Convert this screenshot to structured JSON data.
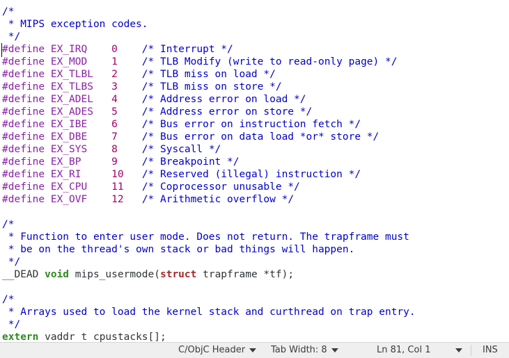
{
  "editor": {
    "lines": [
      [
        {
          "t": "/*",
          "c": "comment"
        }
      ],
      [
        {
          "t": " * MIPS exception codes.",
          "c": "comment"
        }
      ],
      [
        {
          "t": " */",
          "c": "comment"
        }
      ],
      [
        {
          "t": "#define EX_IRQ    ",
          "c": "pre"
        },
        {
          "t": "0",
          "c": "num"
        },
        {
          "t": "    ",
          "c": "text"
        },
        {
          "t": "/* Interrupt */",
          "c": "comment"
        }
      ],
      [
        {
          "t": "#define EX_MOD    ",
          "c": "pre"
        },
        {
          "t": "1",
          "c": "num"
        },
        {
          "t": "    ",
          "c": "text"
        },
        {
          "t": "/* TLB Modify (write to read-only page) */",
          "c": "comment"
        }
      ],
      [
        {
          "t": "#define EX_TLBL   ",
          "c": "pre"
        },
        {
          "t": "2",
          "c": "num"
        },
        {
          "t": "    ",
          "c": "text"
        },
        {
          "t": "/* TLB miss on load */",
          "c": "comment"
        }
      ],
      [
        {
          "t": "#define EX_TLBS   ",
          "c": "pre"
        },
        {
          "t": "3",
          "c": "num"
        },
        {
          "t": "    ",
          "c": "text"
        },
        {
          "t": "/* TLB miss on store */",
          "c": "comment"
        }
      ],
      [
        {
          "t": "#define EX_ADEL   ",
          "c": "pre"
        },
        {
          "t": "4",
          "c": "num"
        },
        {
          "t": "    ",
          "c": "text"
        },
        {
          "t": "/* Address error on load */",
          "c": "comment"
        }
      ],
      [
        {
          "t": "#define EX_ADES   ",
          "c": "pre"
        },
        {
          "t": "5",
          "c": "num"
        },
        {
          "t": "    ",
          "c": "text"
        },
        {
          "t": "/* Address error on store */",
          "c": "comment"
        }
      ],
      [
        {
          "t": "#define EX_IBE    ",
          "c": "pre"
        },
        {
          "t": "6",
          "c": "num"
        },
        {
          "t": "    ",
          "c": "text"
        },
        {
          "t": "/* Bus error on instruction fetch */",
          "c": "comment"
        }
      ],
      [
        {
          "t": "#define EX_DBE    ",
          "c": "pre"
        },
        {
          "t": "7",
          "c": "num"
        },
        {
          "t": "    ",
          "c": "text"
        },
        {
          "t": "/* Bus error on data load *or* store */",
          "c": "comment"
        }
      ],
      [
        {
          "t": "#define EX_SYS    ",
          "c": "pre"
        },
        {
          "t": "8",
          "c": "num"
        },
        {
          "t": "    ",
          "c": "text"
        },
        {
          "t": "/* Syscall */",
          "c": "comment"
        }
      ],
      [
        {
          "t": "#define EX_BP     ",
          "c": "pre"
        },
        {
          "t": "9",
          "c": "num"
        },
        {
          "t": "    ",
          "c": "text"
        },
        {
          "t": "/* Breakpoint */",
          "c": "comment"
        }
      ],
      [
        {
          "t": "#define EX_RI     ",
          "c": "pre"
        },
        {
          "t": "10",
          "c": "num"
        },
        {
          "t": "   ",
          "c": "text"
        },
        {
          "t": "/* Reserved (illegal) instruction */",
          "c": "comment"
        }
      ],
      [
        {
          "t": "#define EX_CPU    ",
          "c": "pre"
        },
        {
          "t": "11",
          "c": "num"
        },
        {
          "t": "   ",
          "c": "text"
        },
        {
          "t": "/* Coprocessor unusable */",
          "c": "comment"
        }
      ],
      [
        {
          "t": "#define EX_OVF    ",
          "c": "pre"
        },
        {
          "t": "12",
          "c": "num"
        },
        {
          "t": "   ",
          "c": "text"
        },
        {
          "t": "/* Arithmetic overflow */",
          "c": "comment"
        }
      ],
      [],
      [
        {
          "t": "/*",
          "c": "comment"
        }
      ],
      [
        {
          "t": " * Function to enter user mode. Does not return. The trapframe must",
          "c": "comment"
        }
      ],
      [
        {
          "t": " * be on the thread's own stack or bad things will happen.",
          "c": "comment"
        }
      ],
      [
        {
          "t": " */",
          "c": "comment"
        }
      ],
      [
        {
          "t": "__DEAD ",
          "c": "text"
        },
        {
          "t": "void",
          "c": "type"
        },
        {
          "t": " mips_usermode(",
          "c": "text"
        },
        {
          "t": "struct",
          "c": "kw"
        },
        {
          "t": " trapframe *tf);",
          "c": "text"
        }
      ],
      [],
      [
        {
          "t": "/*",
          "c": "comment"
        }
      ],
      [
        {
          "t": " * Arrays used to load the kernel stack and curthread on trap entry.",
          "c": "comment"
        }
      ],
      [
        {
          "t": " */",
          "c": "comment"
        }
      ],
      [
        {
          "t": "extern",
          "c": "extern"
        },
        {
          "t": " vaddr_t cpustacks[];",
          "c": "text"
        }
      ]
    ]
  },
  "statusbar": {
    "language": "C/ObjC Header",
    "tab_width": "Tab Width: 8",
    "cursor_position": "Ln 81, Col 1",
    "insert_mode": "INS",
    "dropdown_icon": "chevron-down-icon"
  }
}
